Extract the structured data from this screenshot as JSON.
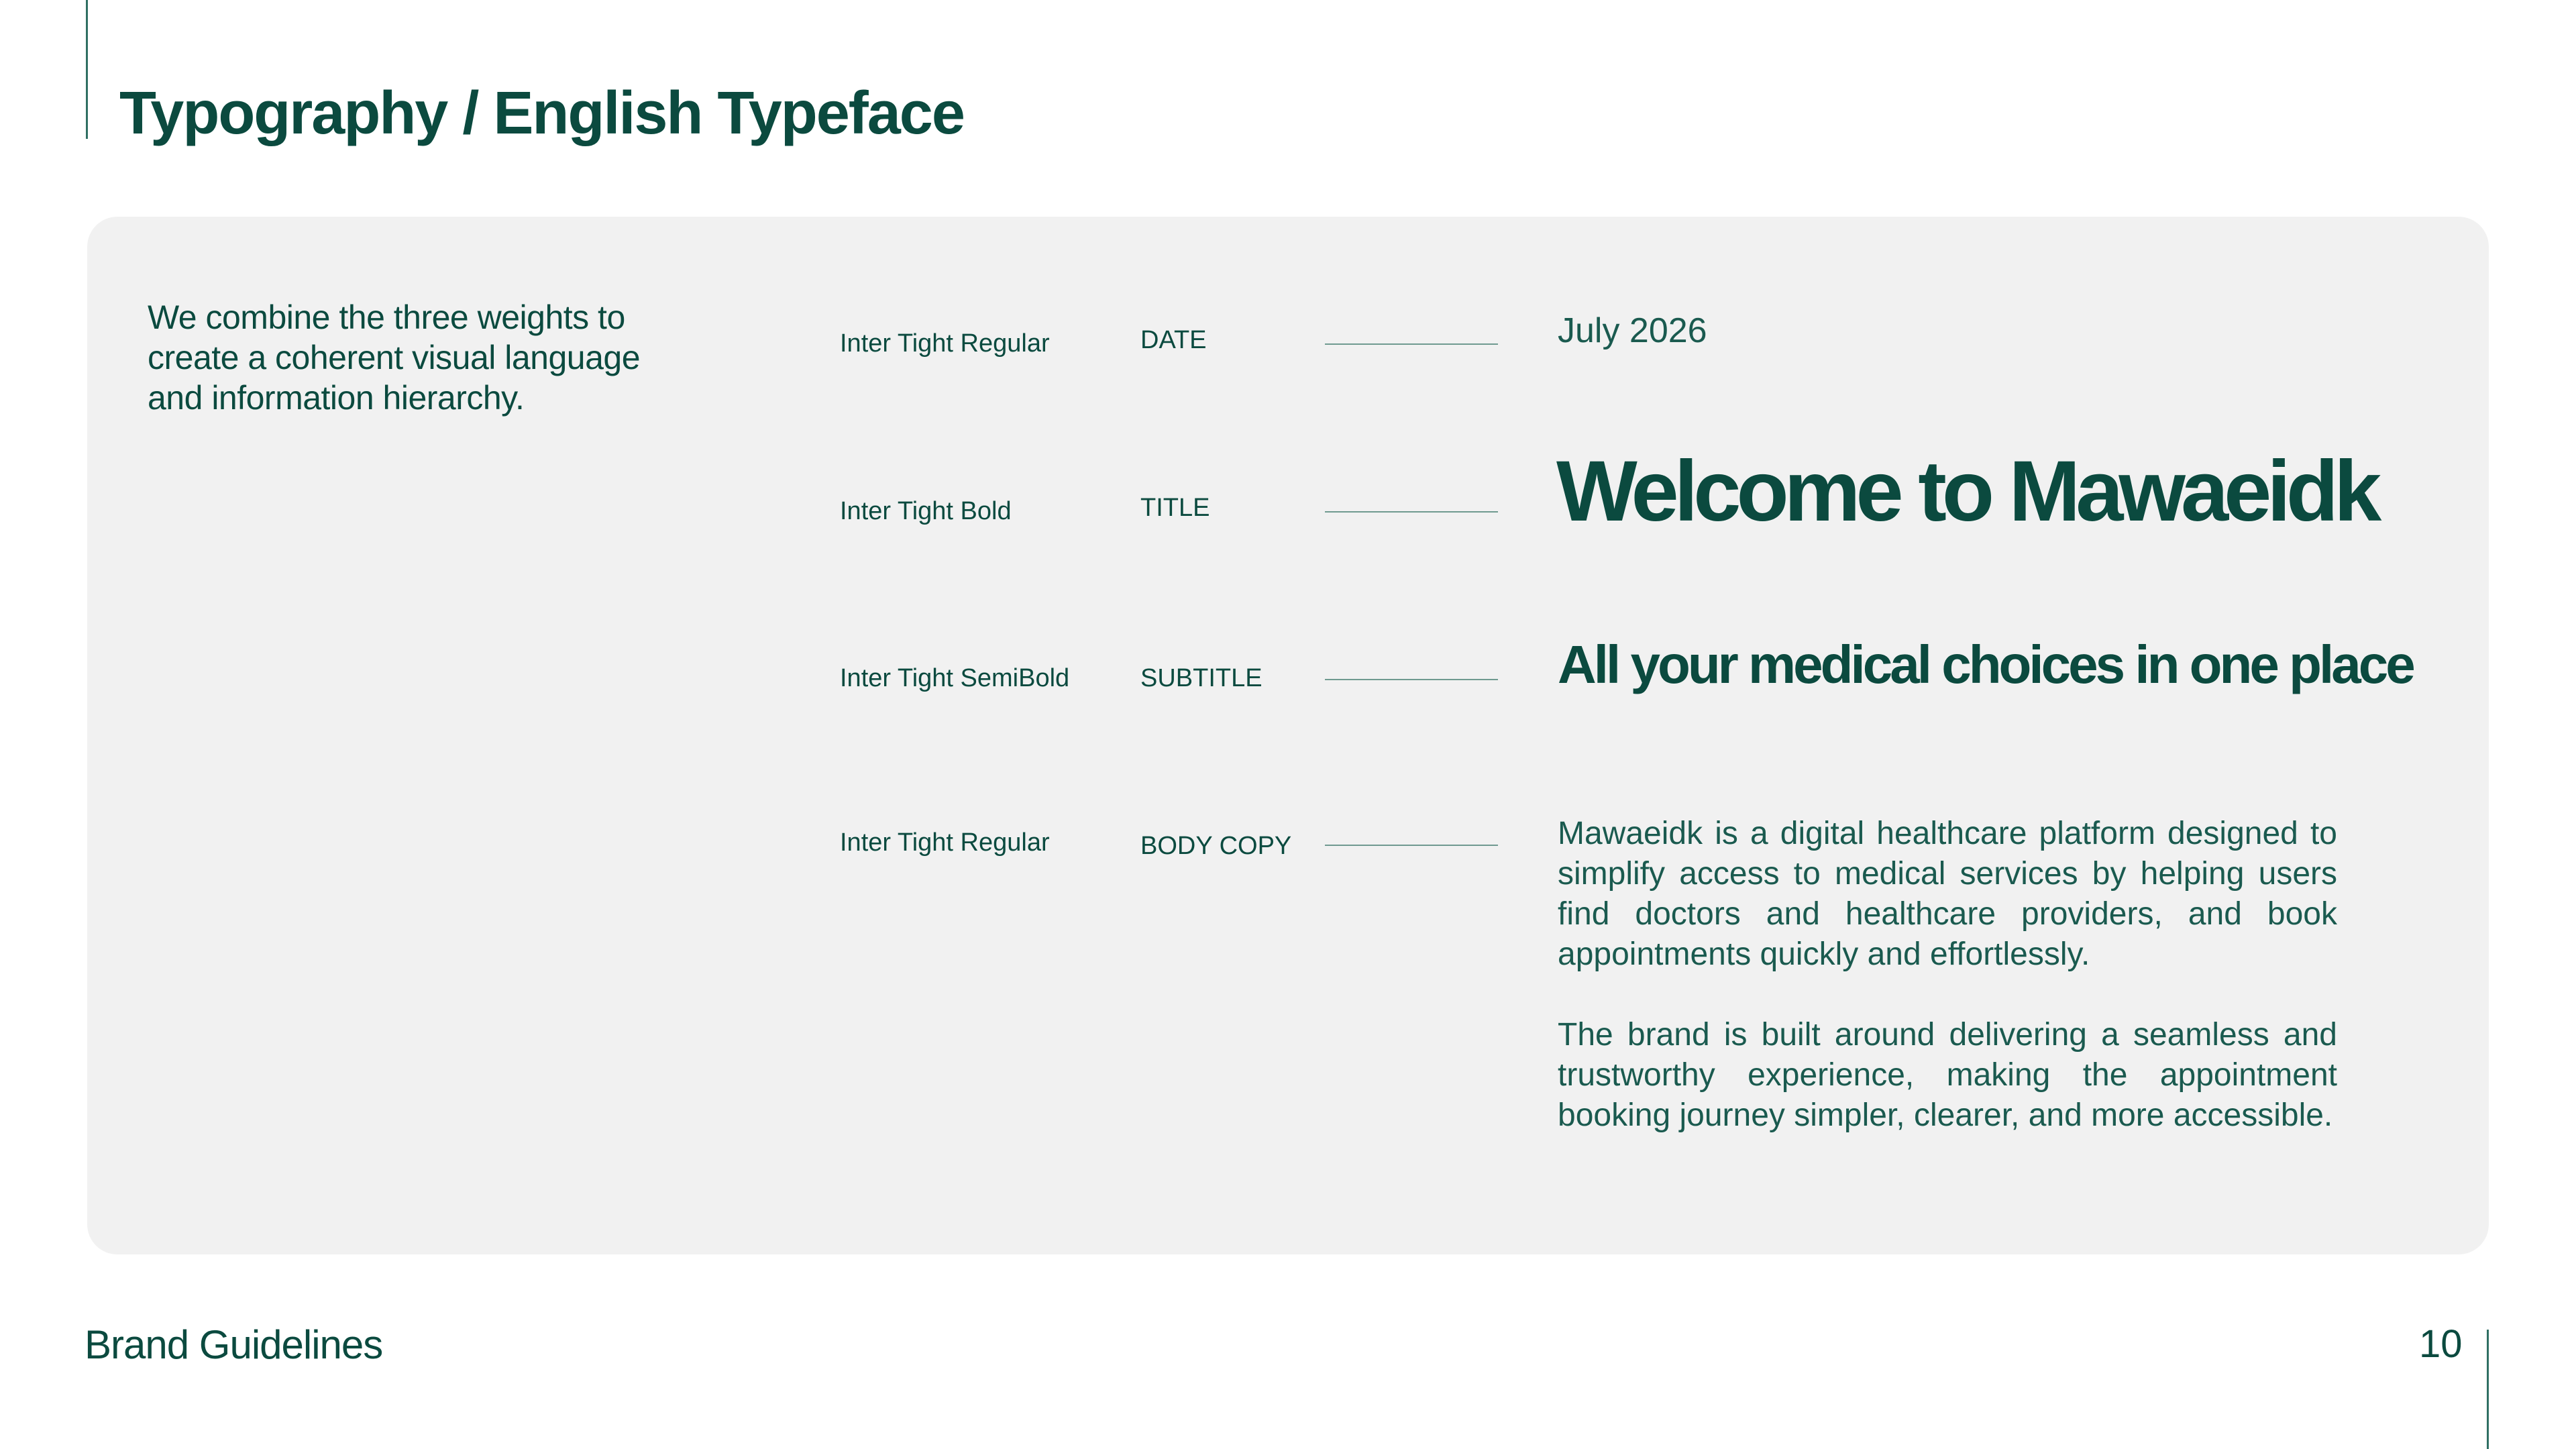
{
  "header": {
    "title": "Typography / English Typeface"
  },
  "panel": {
    "intro": "We combine the three weights to create a coherent visual language and information hierarchy.",
    "rows": [
      {
        "font": "Inter Tight Regular",
        "role": "DATE"
      },
      {
        "font": "Inter Tight Bold",
        "role": "TITLE"
      },
      {
        "font": "Inter Tight SemiBold",
        "role": "SUBTITLE"
      },
      {
        "font": "Inter Tight Regular",
        "role": "BODY COPY"
      }
    ],
    "samples": {
      "date": "July 2026",
      "title": "Welcome to Mawaeidk",
      "subtitle": "All your medical choices in one place",
      "body": [
        "Mawaeidk is a digital healthcare platform designed to simplify access to medical services by helping users find doctors and healthcare providers, and book appointments quickly and effortlessly.",
        "The brand is built around delivering a seamless and trustworthy experience, making the appointment booking journey simpler, clearer, and more accessible."
      ]
    }
  },
  "footer": {
    "label": "Brand Guidelines",
    "page_number": "10"
  },
  "colors": {
    "primary": "#0b4a3f",
    "panel_background": "#f1f1f1",
    "connector_line": "#6f9a90"
  }
}
